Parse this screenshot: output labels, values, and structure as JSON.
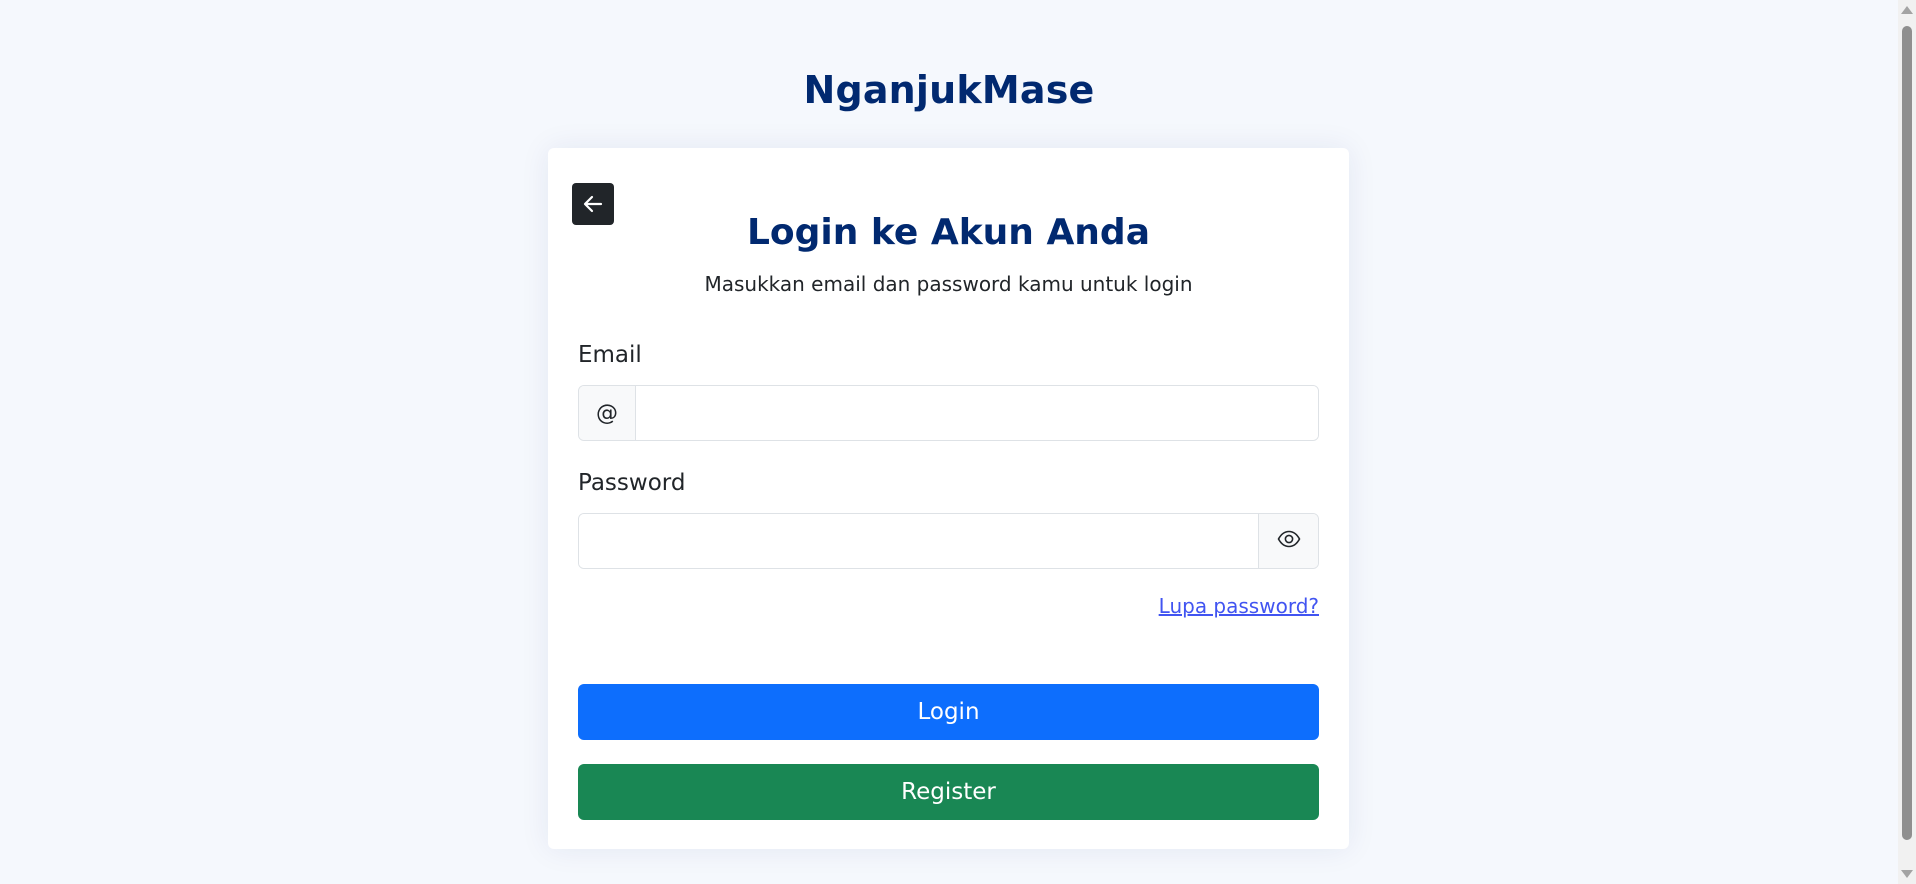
{
  "brand": {
    "name": "NganjukMase"
  },
  "login_card": {
    "back_icon": "arrow-left-icon",
    "title": "Login ke Akun Anda",
    "subtitle": "Masukkan email dan password kamu untuk login",
    "email": {
      "label": "Email",
      "prefix": "@",
      "value": "",
      "placeholder": ""
    },
    "password": {
      "label": "Password",
      "value": "",
      "placeholder": "",
      "toggle_icon": "eye-icon"
    },
    "forgot_label": "Lupa password?",
    "login_label": "Login",
    "register_label": "Register"
  },
  "colors": {
    "page_background": "#f5f8fd",
    "brand": "#012970",
    "login_button": "#0d6efd",
    "register_button": "#198754",
    "link": "#4154f1",
    "back_button": "#212529"
  }
}
